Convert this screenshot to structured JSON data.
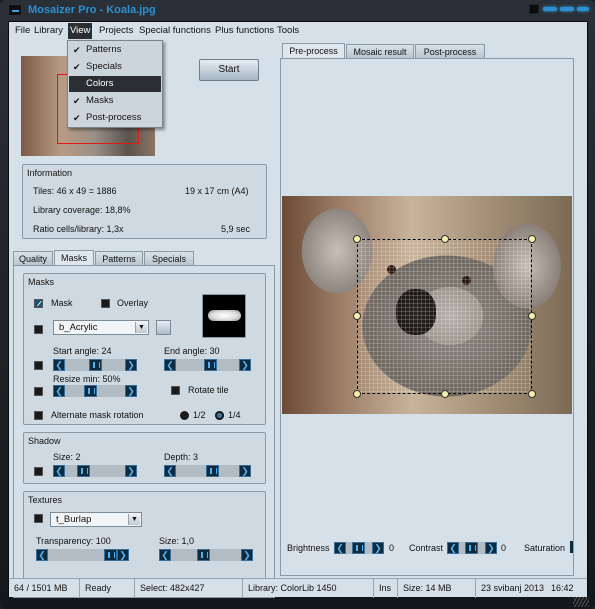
{
  "window": {
    "title": "Mosaizer Pro - Koala.jpg"
  },
  "menubar": {
    "items": [
      "File",
      "Library",
      "View",
      "Projects",
      "Special functions",
      "Plus functions",
      "Tools"
    ],
    "active": "View"
  },
  "view_menu": {
    "items": [
      {
        "label": "Patterns",
        "checked": true
      },
      {
        "label": "Specials",
        "checked": true
      },
      {
        "label": "Colors",
        "checked": false,
        "highlighted": true
      },
      {
        "label": "Masks",
        "checked": true
      },
      {
        "label": "Post-process",
        "checked": true
      }
    ],
    "check_glyph": "✔"
  },
  "start_button": {
    "label": "Start"
  },
  "information": {
    "title": "Information",
    "tiles": "Tiles: 46 x 49 = 1886",
    "size": "19 x 17 cm  (A4)",
    "coverage": "Library coverage: 18,8%",
    "ratio": "Ratio cells/library: 1,3x",
    "time": "5,9 sec"
  },
  "left_tabs": [
    "Quality",
    "Masks",
    "Patterns",
    "Specials"
  ],
  "left_tab_active": "Masks",
  "masks": {
    "title": "Masks",
    "mask_label": "Mask",
    "mask_checked": true,
    "overlay_label": "Overlay",
    "overlay_checked": false,
    "mask_combo": "b_Acrylic",
    "start_angle": {
      "label": "Start angle: 24",
      "value": 24,
      "fraction": 0.52
    },
    "end_angle": {
      "label": "End angle: 30",
      "value": 30,
      "fraction": 0.55
    },
    "resize_min": {
      "label": "Resize min: 50%",
      "value": 50,
      "fraction": 0.4
    },
    "rotate_tile": "Rotate tile",
    "alternate": "Alternate mask rotation",
    "radio_half": "1/2",
    "radio_quarter": "1/4",
    "radio_selected": "1/4"
  },
  "shadow": {
    "title": "Shadow",
    "size": {
      "label": "Size: 2",
      "value": 2,
      "fraction": 0.25
    },
    "depth": {
      "label": "Depth: 3",
      "value": 3,
      "fraction": 0.6
    }
  },
  "textures": {
    "title": "Textures",
    "combo": "t_Burlap",
    "transparency": {
      "label": "Transparency: 100",
      "value": 100,
      "fraction": 1.0
    },
    "size": {
      "label": "Size: 1,0",
      "value": "1,0",
      "fraction": 0.45
    }
  },
  "right_tabs": [
    "Pre-process",
    "Mosaic result",
    "Post-process"
  ],
  "right_tab_active": "Pre-process",
  "adjust": {
    "brightness": {
      "label": "Brightness",
      "value": "0"
    },
    "contrast": {
      "label": "Contrast",
      "value": "0"
    },
    "saturation": {
      "label": "Saturation"
    }
  },
  "status": {
    "memory": "64 / 1501 MB",
    "state": "Ready",
    "select": "Select: 482x427",
    "library": "Library: ColorLib 1450",
    "ins": "Ins",
    "size": "Size:  14 MB",
    "date": "23 svibanj 2013",
    "time": "16:42"
  },
  "arrows": {
    "left": "❮",
    "right": "❯",
    "dropdown": "▼"
  },
  "colors": {
    "title": "#2c8fd0",
    "accent": "#4fb2f0",
    "selection": "#e01818"
  }
}
